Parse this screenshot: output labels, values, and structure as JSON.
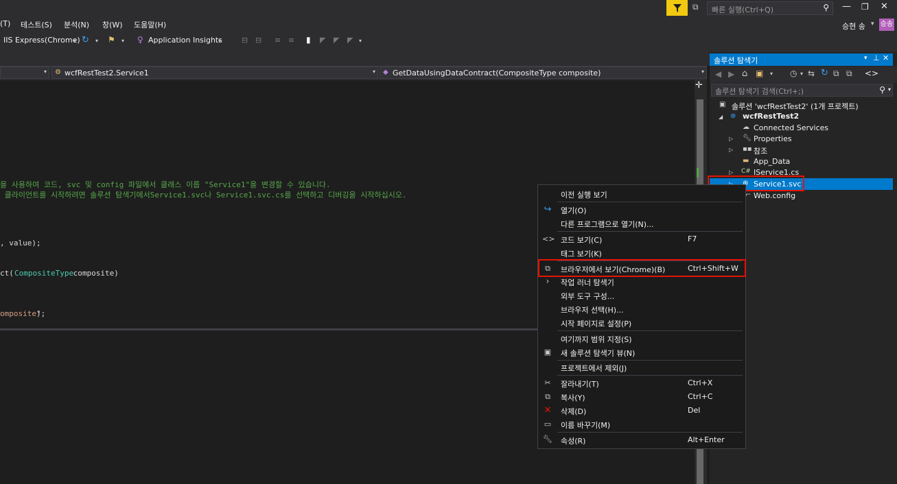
{
  "menu": {
    "items": [
      "(T)",
      "테스트(S)",
      "분석(N)",
      "창(W)",
      "도움말(H)"
    ]
  },
  "quick_launch": {
    "placeholder": "빠른 실행(Ctrl+Q)"
  },
  "user": {
    "name": "승현 송",
    "avatar": "승송"
  },
  "toolbar": {
    "run_target": "IIS Express(Chrome)",
    "insights": "Application Insights"
  },
  "nav": {
    "class_dropdown": "wcfRestTest2.Service1",
    "member_dropdown": "GetDataUsingDataContract(CompositeType composite)"
  },
  "code": {
    "line1": "을 사용하여 코드, svc 및 config 파일에서 클래스 이름 \"Service1\"을 변경할 수 있습니다.",
    "line2": " 클라이언트를 시작하려면 솔루션 탐색기에서Service1.svc나 Service1.svc.cs를 선택하고 디버깅을 시작하십시오.",
    "line3": ", value);",
    "line4_prefix": "ct(",
    "line4_type": "CompositeType",
    "line4_suffix": " composite)",
    "line5_str": "omposite\"",
    "line5_suffix": ");"
  },
  "solution_explorer": {
    "title": "솔루션 탐색기",
    "search_placeholder": "솔루션 탐색기 검색(Ctrl+;)",
    "solution": "솔루션 'wcfRestTest2' (1개 프로젝트)",
    "project": "wcfRestTest2",
    "items": [
      {
        "label": "Connected Services",
        "icon": "cloud-icon"
      },
      {
        "label": "Properties",
        "icon": "wrench-icon"
      },
      {
        "label": "참조",
        "icon": "reference-icon"
      },
      {
        "label": "App_Data",
        "icon": "folder-icon"
      },
      {
        "label": "IService1.cs",
        "icon": "csharp-file-icon"
      },
      {
        "label": "Service1.svc",
        "icon": "web-service-icon"
      },
      {
        "label": "Web.config",
        "icon": "config-file-icon"
      }
    ]
  },
  "context_menu": {
    "items": [
      {
        "label": "이전 실행 보기",
        "shortcut": ""
      },
      {
        "label": "열기(O)",
        "shortcut": ""
      },
      {
        "label": "다른 프로그램으로 열기(N)...",
        "shortcut": ""
      },
      {
        "label": "코드 보기(C)",
        "shortcut": "F7"
      },
      {
        "label": "태그 보기(K)",
        "shortcut": ""
      },
      {
        "label": "브라우저에서 보기(Chrome)(B)",
        "shortcut": "Ctrl+Shift+W"
      },
      {
        "label": "작업 러너 탐색기",
        "shortcut": ""
      },
      {
        "label": "외부 도구 구성...",
        "shortcut": ""
      },
      {
        "label": "브라우저 선택(H)...",
        "shortcut": ""
      },
      {
        "label": "시작 페이지로 설정(P)",
        "shortcut": ""
      },
      {
        "label": "여기까지 범위 지정(S)",
        "shortcut": ""
      },
      {
        "label": "새 솔루션 탐색기 뷰(N)",
        "shortcut": ""
      },
      {
        "label": "프로젝트에서 제외(J)",
        "shortcut": ""
      },
      {
        "label": "잘라내기(T)",
        "shortcut": "Ctrl+X"
      },
      {
        "label": "복사(Y)",
        "shortcut": "Ctrl+C"
      },
      {
        "label": "삭제(D)",
        "shortcut": "Del"
      },
      {
        "label": "이름 바꾸기(M)",
        "shortcut": ""
      },
      {
        "label": "속성(R)",
        "shortcut": "Alt+Enter"
      }
    ]
  },
  "colors": {
    "accent": "#007acc",
    "highlight_box": "#e51400",
    "filter": "#f2c811"
  }
}
